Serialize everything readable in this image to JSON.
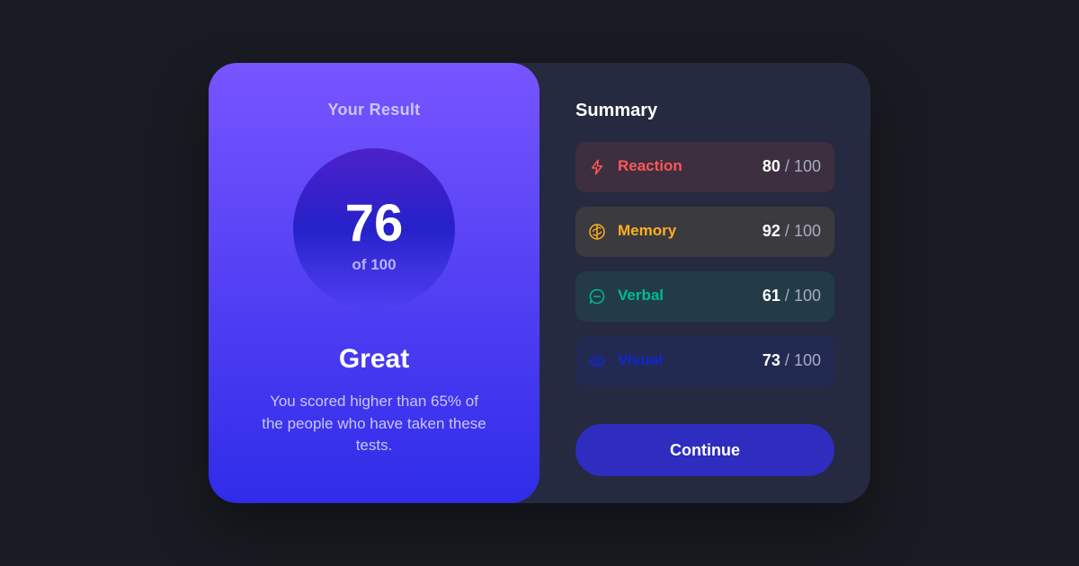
{
  "result": {
    "heading": "Your Result",
    "score": "76",
    "total": "of 100",
    "rating": "Great",
    "description": "You scored higher than 65% of the people who have taken these tests."
  },
  "summary": {
    "heading": "Summary",
    "items": [
      {
        "label": "Reaction",
        "score": "80",
        "separator": "/",
        "max": "100",
        "icon": "lightning-icon",
        "accent": "#ff5757",
        "bg": "#3d2f3f"
      },
      {
        "label": "Memory",
        "score": "92",
        "separator": "/",
        "max": "100",
        "icon": "brain-icon",
        "accent": "#ffb01f",
        "bg": "#3b3a3f"
      },
      {
        "label": "Verbal",
        "score": "61",
        "separator": "/",
        "max": "100",
        "icon": "chat-bubble-icon",
        "accent": "#00bb8f",
        "bg": "#233b47"
      },
      {
        "label": "Visual",
        "score": "73",
        "separator": "/",
        "max": "100",
        "icon": "eye-icon",
        "accent": "#1125d6",
        "bg": "#222a51"
      }
    ]
  },
  "continue_label": "Continue",
  "colors": {
    "background": "#191b22",
    "card": "#252a40",
    "gradient_top": "#7755ff",
    "gradient_bottom": "#2f2ce9",
    "button": "#2f2cc0"
  }
}
